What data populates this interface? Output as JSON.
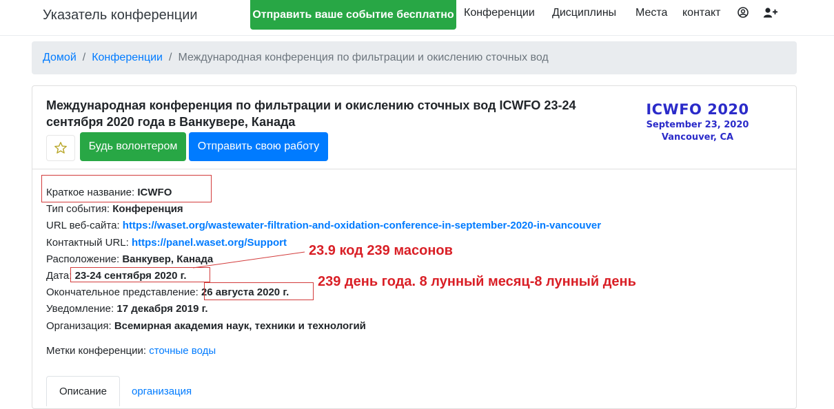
{
  "navbar": {
    "brand": "Указатель конференции",
    "submit_label": "Отправить ваше событие бесплатно",
    "links": [
      "Конференции",
      "Дисциплины",
      "Места",
      "контакт"
    ],
    "icons": [
      "user-circle-icon",
      "user-plus-icon"
    ]
  },
  "breadcrumb": {
    "home": "Домой",
    "conferences": "Конференции",
    "current": "Международная конференция по фильтрации и окислению сточных вод"
  },
  "header": {
    "title": "Международная конференция по фильтрации и окислению сточных вод ICWFO 23-24 сентября 2020 года в Ванкувере, Канада",
    "volunteer_label": "Будь волонтером",
    "paper_label": "Отправить свою работу",
    "logo": {
      "name": "ICWFO 2020",
      "date": "September 23, 2020",
      "place": "Vancouver, CA"
    }
  },
  "details": {
    "short_name_label": "Краткое название:",
    "short_name": "ICWFO",
    "event_type_label": "Тип события:",
    "event_type": "Конференция",
    "website_label": "URL веб-сайта:",
    "website": "https://waset.org/wastewater-filtration-and-oxidation-conference-in-september-2020-in-vancouver",
    "contact_label": "Контактный URL:",
    "contact": "https://panel.waset.org/Support",
    "location_label": "Расположение:",
    "location": "Ванкувер, Канада",
    "date_label": "Дата:",
    "date": "23-24 сентября 2020 г.",
    "final_label": "Окончательное представление:",
    "final": "26 августа 2020 г.",
    "notification_label": "Уведомление:",
    "notification": "17 декабря 2019 г.",
    "organization_label": "Организация:",
    "organization": "Всемирная академия наук, техники и технологий"
  },
  "tags": {
    "label": "Метки конференции:",
    "value": "сточные воды"
  },
  "tabs": [
    "Описание",
    "организация"
  ],
  "annotations": {
    "note1": "23.9 код 239 масонов",
    "note2": "239 день года. 8 лунный месяц-8 лунный день",
    "color": "#d91f26"
  }
}
